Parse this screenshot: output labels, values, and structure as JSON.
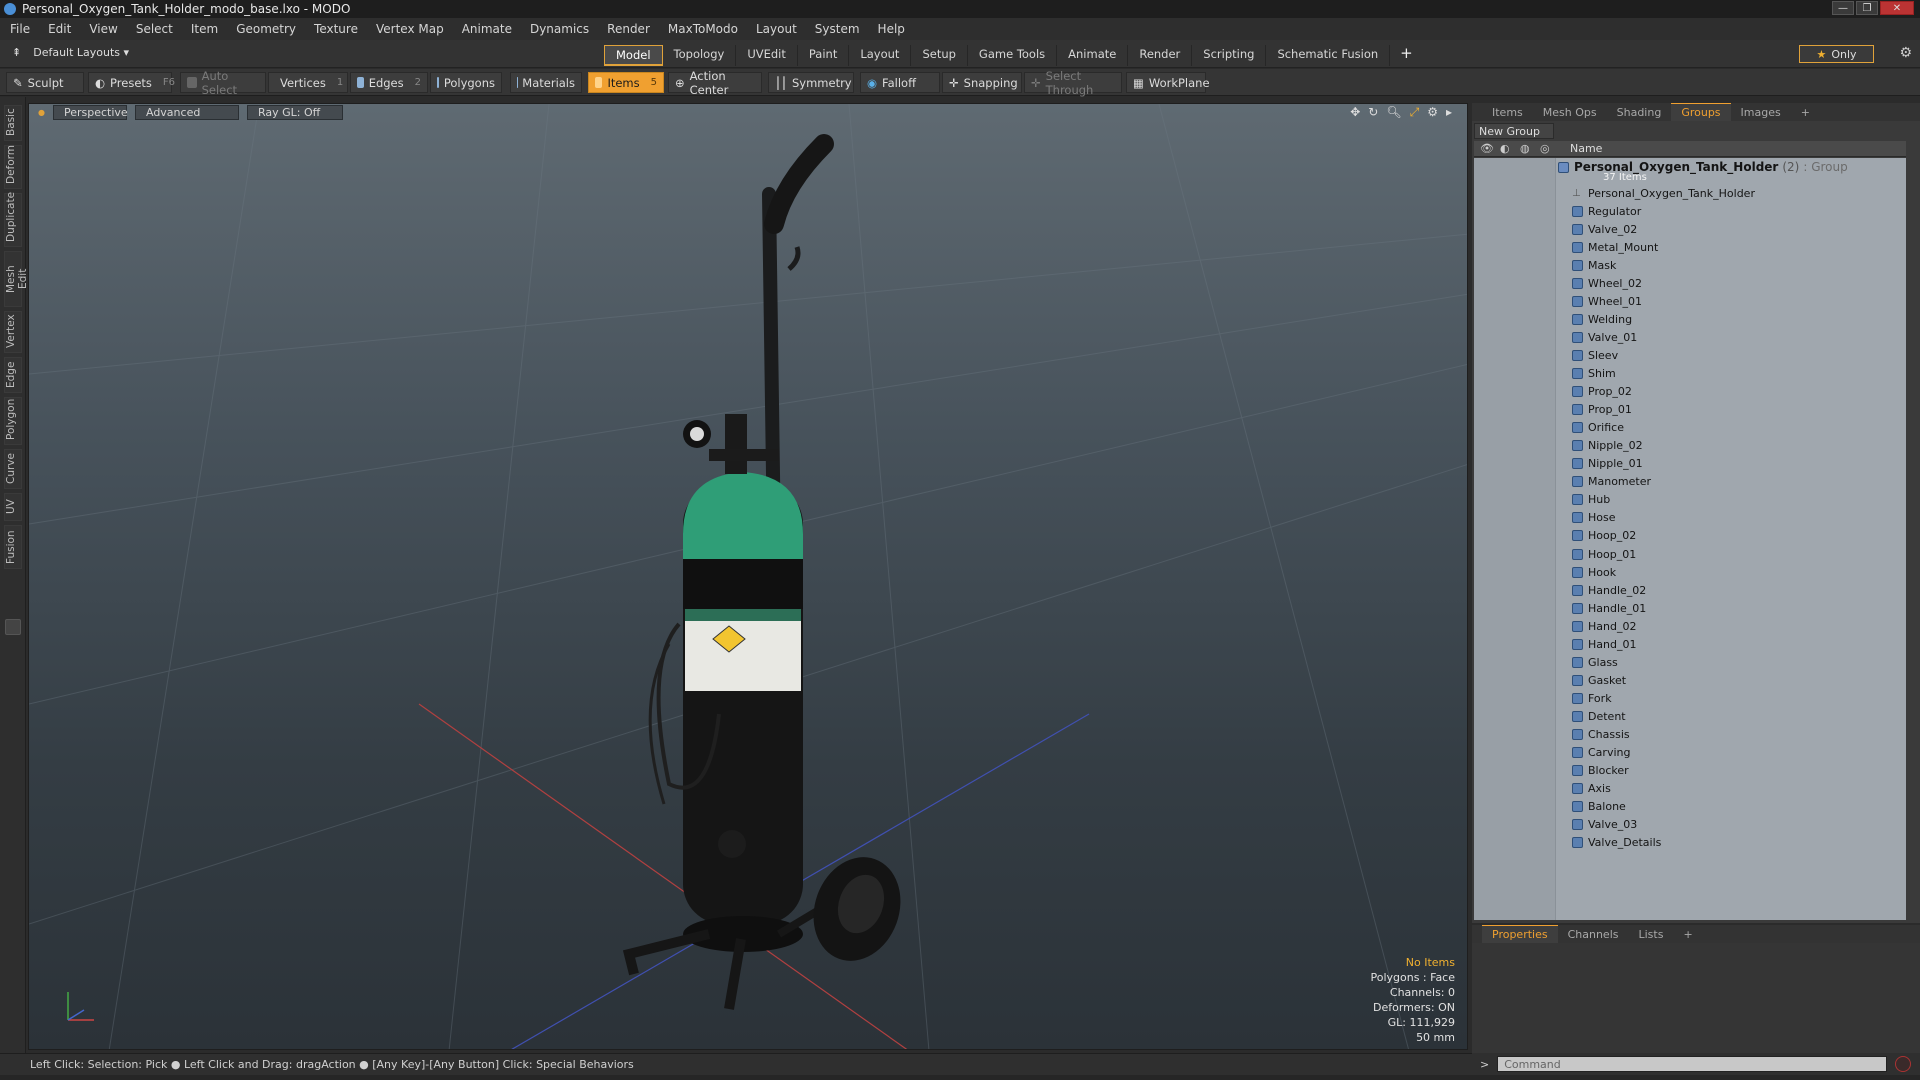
{
  "window": {
    "title": "Personal_Oxygen_Tank_Holder_modo_base.lxo - MODO",
    "controls": [
      "—",
      "❐",
      "✕"
    ]
  },
  "menu": [
    "File",
    "Edit",
    "View",
    "Select",
    "Item",
    "Geometry",
    "Texture",
    "Vertex Map",
    "Animate",
    "Dynamics",
    "Render",
    "MaxToModo",
    "Layout",
    "System",
    "Help"
  ],
  "layoutbar": {
    "layout_label": "Default Layouts ▾",
    "tabs": [
      "Model",
      "Topology",
      "UVEdit",
      "Paint",
      "Layout",
      "Setup",
      "Game Tools",
      "Animate",
      "Render",
      "Scripting",
      "Schematic Fusion"
    ],
    "active_tab": "Model",
    "add": "+",
    "only_label": "Only"
  },
  "toolbar": {
    "sculpt": "Sculpt",
    "presets": "Presets",
    "presets_key": "F6",
    "auto_select": "Auto Select",
    "vertices": "Vertices",
    "vertices_num": "1",
    "edges": "Edges",
    "edges_num": "2",
    "polygons": "Polygons",
    "materials": "Materials",
    "items": "Items",
    "items_num": "5",
    "action_center": "Action Center",
    "symmetry": "Symmetry",
    "falloff": "Falloff",
    "snapping": "Snapping",
    "select_through": "Select Through",
    "workplane": "WorkPlane"
  },
  "left_tabs": [
    "Basic",
    "Deform",
    "Duplicate",
    "Mesh Edit",
    "Vertex",
    "Edge",
    "Polygon",
    "Curve",
    "UV",
    "Fusion"
  ],
  "viewport": {
    "view": "Perspective",
    "mode": "Advanced",
    "raygl": "Ray GL: Off",
    "info": {
      "items": "No Items",
      "polygons": "Polygons : Face",
      "channels": "Channels: 0",
      "deformers": "Deformers: ON",
      "gl": "GL: 111,929",
      "scale": "50 mm"
    }
  },
  "status": "Left Click: Selection: Pick ● Left Click and Drag: dragAction ● [Any Key]-[Any Button] Click: Special Behaviors",
  "right_panel": {
    "tabs": [
      "Items",
      "Mesh Ops",
      "Shading",
      "Groups",
      "Images",
      "+"
    ],
    "active_tab": "Groups",
    "new_group": "New Group",
    "column_name": "Name",
    "group": {
      "name": "Personal_Oxygen_Tank_Holder",
      "count": "(2)",
      "type": ": Group",
      "items_count": "37 Items"
    },
    "items": [
      "Personal_Oxygen_Tank_Holder",
      "Regulator",
      "Valve_02",
      "Metal_Mount",
      "Mask",
      "Wheel_02",
      "Wheel_01",
      "Welding",
      "Valve_01",
      "Sleev",
      "Shim",
      "Prop_02",
      "Prop_01",
      "Orifice",
      "Nipple_02",
      "Nipple_01",
      "Manometer",
      "Hub",
      "Hose",
      "Hoop_02",
      "Hoop_01",
      "Hook",
      "Handle_02",
      "Handle_01",
      "Hand_02",
      "Hand_01",
      "Glass",
      "Gasket",
      "Fork",
      "Detent",
      "Chassis",
      "Carving",
      "Blocker",
      "Axis",
      "Balone",
      "Valve_03",
      "Valve_Details"
    ]
  },
  "properties_panel": {
    "tabs": [
      "Properties",
      "Channels",
      "Lists",
      "+"
    ],
    "active_tab": "Properties"
  },
  "command": {
    "placeholder": "Command",
    "prompt": ">"
  },
  "colors": {
    "accent": "#f0a030",
    "tank_green": "#2f9e77",
    "viewport_top": "#5f6a72",
    "viewport_bottom": "#2b3238"
  }
}
